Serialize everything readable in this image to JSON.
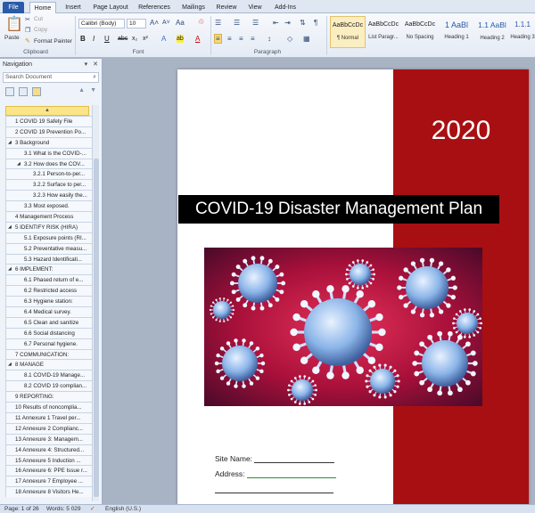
{
  "tabs": [
    "File",
    "Home",
    "Insert",
    "Page Layout",
    "References",
    "Mailings",
    "Review",
    "View",
    "Add-Ins"
  ],
  "ribbon": {
    "clipboard": {
      "paste": "Paste",
      "cut": "Cut",
      "copy": "Copy",
      "format_painter": "Format Painter",
      "label": "Clipboard"
    },
    "font": {
      "name": "Calibri (Body)",
      "size": "10",
      "label": "Font"
    },
    "paragraph": {
      "label": "Paragraph"
    },
    "styles": [
      {
        "sample": "AaBbCcDc",
        "name": "¶ Normal"
      },
      {
        "sample": "AaBbCcDc",
        "name": "List Paragr..."
      },
      {
        "sample": "AaBbCcDc",
        "name": "No Spacing"
      },
      {
        "sample": "1 AaBl",
        "name": "Heading 1"
      },
      {
        "sample": "1.1 AaBl",
        "name": "Heading 2"
      },
      {
        "sample": "1.1.1",
        "name": "Heading 3"
      }
    ]
  },
  "nav": {
    "title": "Navigation",
    "search_placeholder": "Search Document",
    "items": [
      {
        "label": "1 COVID 19 Safety File",
        "level": 1
      },
      {
        "label": "2 COVID 19 Prevention Po...",
        "level": 1
      },
      {
        "label": "3 Background",
        "level": 1,
        "expanded": true
      },
      {
        "label": "3.1 What is the COVID-...",
        "level": 2
      },
      {
        "label": "3.2 How does the COV...",
        "level": 2,
        "expanded": true
      },
      {
        "label": "3.2.1 Person-to-per...",
        "level": 3
      },
      {
        "label": "3.2.2 Surface to per...",
        "level": 3
      },
      {
        "label": "3.2.3 How easily the...",
        "level": 3
      },
      {
        "label": "3.3 Most exposed.",
        "level": 2
      },
      {
        "label": "4 Management Process",
        "level": 1
      },
      {
        "label": "5 IDENTIFY RISK (HIRA)",
        "level": 1,
        "expanded": true
      },
      {
        "label": "5.1 Exposure points (RI...",
        "level": 2
      },
      {
        "label": "5.2 Preventative measu...",
        "level": 2
      },
      {
        "label": "5.3 Hazard Identificati...",
        "level": 2
      },
      {
        "label": "6 IMPLEMENT:",
        "level": 1,
        "expanded": true
      },
      {
        "label": "6.1 Phased return of e...",
        "level": 2
      },
      {
        "label": "6.2 Restricted access",
        "level": 2
      },
      {
        "label": "6.3 Hygiene station:",
        "level": 2
      },
      {
        "label": "6.4 Medical survey.",
        "level": 2
      },
      {
        "label": "6.5 Clean and sanitize",
        "level": 2
      },
      {
        "label": "6.6 Social distancing",
        "level": 2
      },
      {
        "label": "6.7 Personal hygiene.",
        "level": 2
      },
      {
        "label": "7 COMMUNICATION:",
        "level": 1
      },
      {
        "label": "8 MANAGE",
        "level": 1,
        "expanded": true
      },
      {
        "label": "8.1 COVID-19 Manage...",
        "level": 2
      },
      {
        "label": "8.2 COVID 19 complian...",
        "level": 2
      },
      {
        "label": "9 REPORTING:",
        "level": 1
      },
      {
        "label": "10 Results of noncomplia...",
        "level": 1
      },
      {
        "label": "11 Annexure 1 Travel per...",
        "level": 1
      },
      {
        "label": "12 Annexure 2 Complianc...",
        "level": 1
      },
      {
        "label": "13 Annexure 3: Managem...",
        "level": 1
      },
      {
        "label": "14 Annexure 4: Structured...",
        "level": 1
      },
      {
        "label": "15 Annexure 5 Induction ...",
        "level": 1
      },
      {
        "label": "16 Annexure 6: PPE Issue r...",
        "level": 1
      },
      {
        "label": "17 Annexure 7 Employee ...",
        "level": 1
      },
      {
        "label": "18 Annexure 8 Visitors He...",
        "level": 1
      }
    ]
  },
  "document": {
    "year": "2020",
    "title": "COVID-19 Disaster Management  Plan",
    "site_name_label": "Site Name:",
    "address_label": "Address:"
  },
  "status": {
    "page": "Page: 1 of 26",
    "words": "Words: 5 029",
    "language": "English (U.S.)"
  },
  "colors": {
    "band": "#a80f12",
    "file_tab": "#2a5aa8",
    "title_bar": "#000000"
  }
}
